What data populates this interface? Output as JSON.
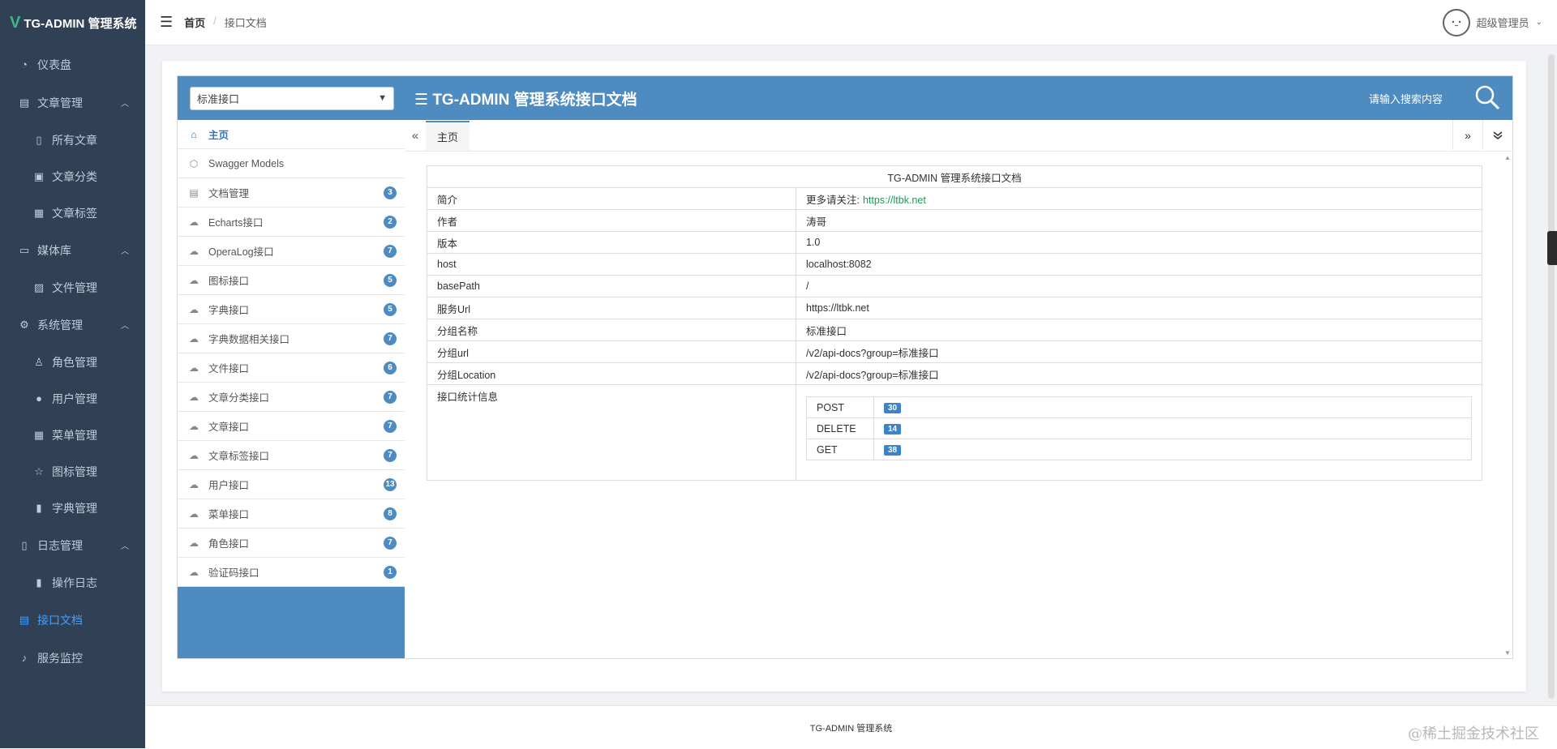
{
  "app": {
    "logo_mark": "V",
    "title": "TG-ADMIN 管理系统"
  },
  "sidebar": {
    "items": [
      {
        "label": "仪表盘",
        "icon": "dashboard-icon",
        "sub": false,
        "arrow": false
      },
      {
        "label": "文章管理",
        "icon": "document-icon",
        "sub": false,
        "arrow": true
      },
      {
        "label": "所有文章",
        "icon": "book-icon",
        "sub": true,
        "arrow": false
      },
      {
        "label": "文章分类",
        "icon": "category-icon",
        "sub": true,
        "arrow": false
      },
      {
        "label": "文章标签",
        "icon": "grid-icon",
        "sub": true,
        "arrow": false
      },
      {
        "label": "媒体库",
        "icon": "folder-icon",
        "sub": false,
        "arrow": true
      },
      {
        "label": "文件管理",
        "icon": "image-icon",
        "sub": true,
        "arrow": false
      },
      {
        "label": "系统管理",
        "icon": "gear-icon",
        "sub": false,
        "arrow": true
      },
      {
        "label": "角色管理",
        "icon": "role-icon",
        "sub": true,
        "arrow": false
      },
      {
        "label": "用户管理",
        "icon": "user-icon",
        "sub": true,
        "arrow": false
      },
      {
        "label": "菜单管理",
        "icon": "menu-grid-icon",
        "sub": true,
        "arrow": false
      },
      {
        "label": "图标管理",
        "icon": "star-icon",
        "sub": true,
        "arrow": false
      },
      {
        "label": "字典管理",
        "icon": "bar-chart-icon",
        "sub": true,
        "arrow": false
      },
      {
        "label": "日志管理",
        "icon": "log-icon",
        "sub": false,
        "arrow": true
      },
      {
        "label": "操作日志",
        "icon": "bar-chart-icon",
        "sub": true,
        "arrow": false
      },
      {
        "label": "接口文档",
        "icon": "api-doc-icon",
        "sub": false,
        "arrow": false,
        "active": true
      },
      {
        "label": "服务监控",
        "icon": "bell-icon",
        "sub": false,
        "arrow": false
      }
    ]
  },
  "navbar": {
    "breadcrumb_home": "首页",
    "breadcrumb_sep": "/",
    "breadcrumb_current": "接口文档",
    "user_name": "超级管理员"
  },
  "doc": {
    "group_select": "标准接口",
    "header_title": "TG-ADMIN 管理系统接口文档",
    "search_placeholder": "请输入搜索内容",
    "menu": [
      {
        "label": "主页",
        "badge": null,
        "icon": "home-icon"
      },
      {
        "label": "Swagger Models",
        "badge": null,
        "icon": "models-icon"
      },
      {
        "label": "文档管理",
        "badge": "3",
        "icon": "doc-manage-icon"
      },
      {
        "label": "Echarts接口",
        "badge": "2",
        "icon": "cloud-icon"
      },
      {
        "label": "OperaLog接口",
        "badge": "7",
        "icon": "cloud-icon"
      },
      {
        "label": "图标接口",
        "badge": "5",
        "icon": "cloud-icon"
      },
      {
        "label": "字典接口",
        "badge": "5",
        "icon": "cloud-icon"
      },
      {
        "label": "字典数据相关接口",
        "badge": "7",
        "icon": "cloud-icon"
      },
      {
        "label": "文件接口",
        "badge": "6",
        "icon": "cloud-icon"
      },
      {
        "label": "文章分类接口",
        "badge": "7",
        "icon": "cloud-icon"
      },
      {
        "label": "文章接口",
        "badge": "7",
        "icon": "cloud-icon"
      },
      {
        "label": "文章标签接口",
        "badge": "7",
        "icon": "cloud-icon"
      },
      {
        "label": "用户接口",
        "badge": "13",
        "icon": "cloud-icon"
      },
      {
        "label": "菜单接口",
        "badge": "8",
        "icon": "cloud-icon"
      },
      {
        "label": "角色接口",
        "badge": "7",
        "icon": "cloud-icon"
      },
      {
        "label": "验证码接口",
        "badge": "1",
        "icon": "cloud-icon"
      }
    ],
    "tab_label": "主页",
    "tab_prev": "«",
    "tab_next": "»",
    "info_caption": "TG-ADMIN 管理系统接口文档",
    "info_rows": [
      {
        "key": "简介",
        "value": "更多请关注:",
        "link": "https://ltbk.net"
      },
      {
        "key": "作者",
        "value": "涛哥"
      },
      {
        "key": "版本",
        "value": "1.0"
      },
      {
        "key": "host",
        "value": "localhost:8082"
      },
      {
        "key": "basePath",
        "value": "/"
      },
      {
        "key": "服务Url",
        "value": "https://ltbk.net"
      },
      {
        "key": "分组名称",
        "value": "标准接口"
      },
      {
        "key": "分组url",
        "value": "/v2/api-docs?group=标准接口"
      },
      {
        "key": "分组Location",
        "value": "/v2/api-docs?group=标准接口"
      }
    ],
    "stats_label": "接口统计信息",
    "stats": [
      {
        "method": "POST",
        "count": "30"
      },
      {
        "method": "DELETE",
        "count": "14"
      },
      {
        "method": "GET",
        "count": "38"
      }
    ]
  },
  "footer": {
    "text": "TG-ADMIN 管理系统"
  },
  "watermark": "@稀土掘金技术社区",
  "colors": {
    "sidebar_bg": "#304156",
    "accent": "#409eff",
    "doc_blue": "#4e8bc1",
    "link_green": "#1e9a56"
  }
}
